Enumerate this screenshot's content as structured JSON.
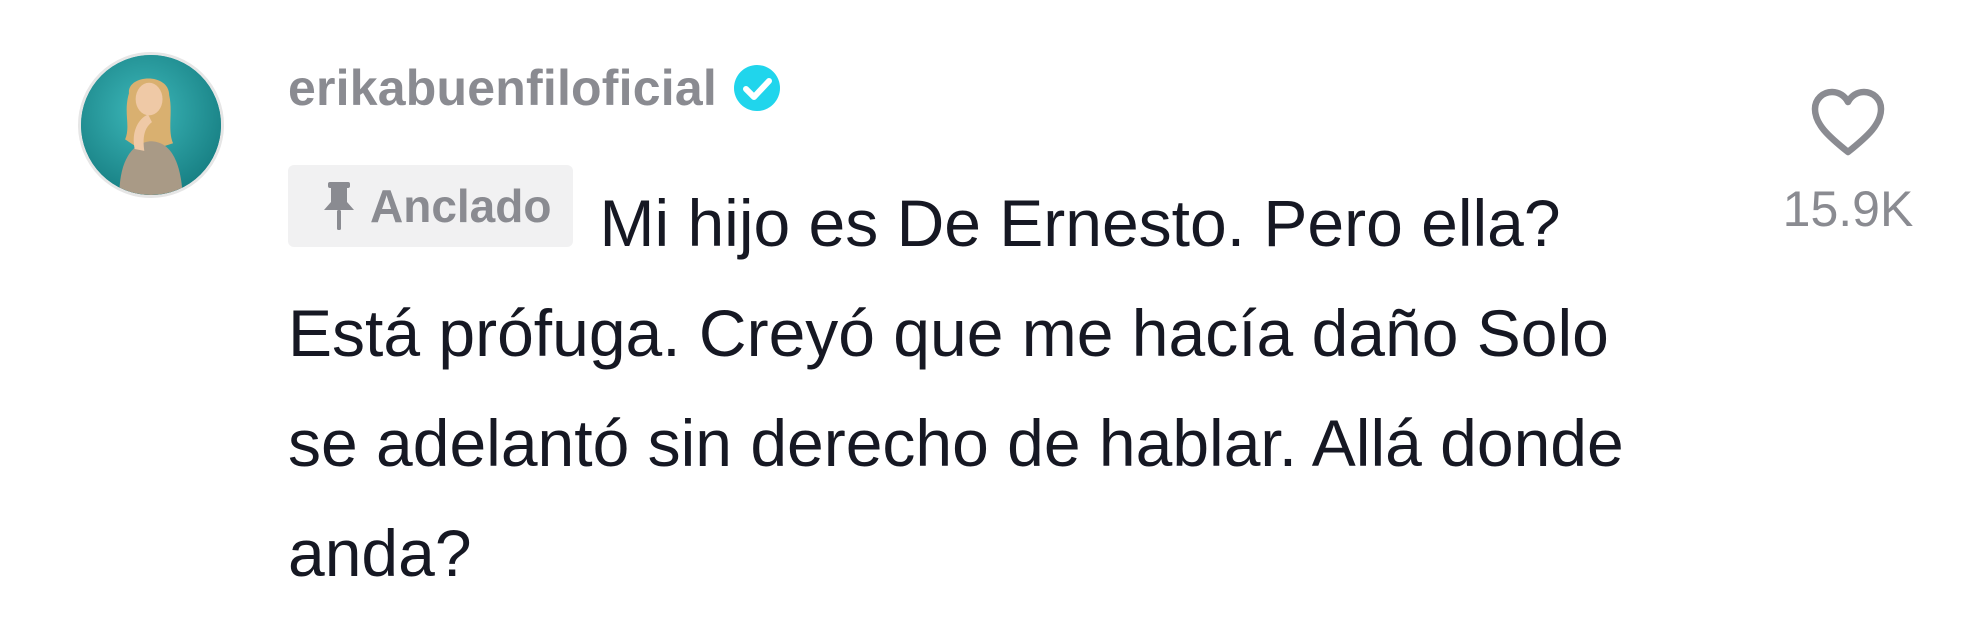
{
  "comment": {
    "username": "erikabuenfiloficial",
    "verified": true,
    "pinned_label": "Anclado",
    "text": "Mi hijo es De Ernesto. Pero ella? Está prófuga. Creyó que me hacía daño Solo se adelantó sin derecho de hablar. Allá donde anda?",
    "like_count": "15.9K"
  },
  "colors": {
    "username": "#8a8b91",
    "verified_badge": "#20d5ec",
    "text": "#161823",
    "pin_badge_bg": "#f1f1f2",
    "secondary": "#8a8b91"
  },
  "icons": {
    "verified": "verified-check-icon",
    "pin": "pin-icon",
    "like": "heart-outline-icon"
  }
}
